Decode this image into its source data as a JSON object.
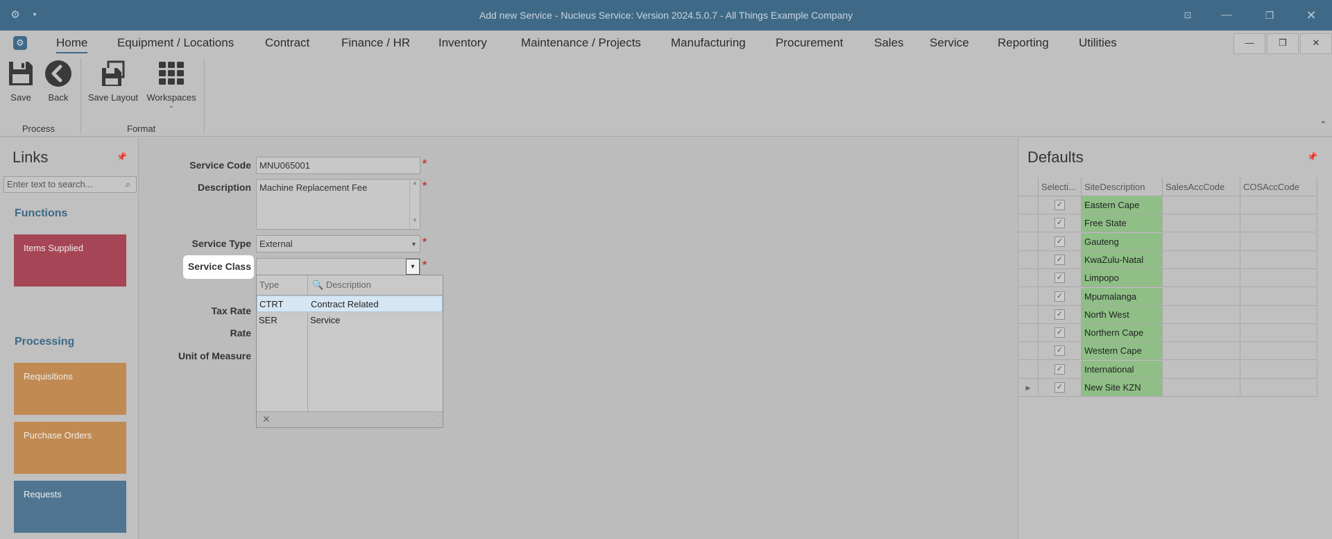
{
  "window": {
    "title": "Add new Service - Nucleus Service: Version 2024.5.0.7 - All Things Example Company"
  },
  "menu": {
    "tabs": [
      "Home",
      "Equipment / Locations",
      "Contract",
      "Finance / HR",
      "Inventory",
      "Maintenance / Projects",
      "Manufacturing",
      "Procurement",
      "Sales",
      "Service",
      "Reporting",
      "Utilities"
    ]
  },
  "ribbon": {
    "save": "Save",
    "back": "Back",
    "save_layout": "Save Layout",
    "workspaces": "Workspaces",
    "group_process": "Process",
    "group_format": "Format"
  },
  "links": {
    "title": "Links",
    "search_placeholder": "Enter text to search...",
    "functions_header": "Functions",
    "processing_header": "Processing",
    "tiles": {
      "items_supplied": "Items Supplied",
      "requisitions": "Requisitions",
      "purchase_orders": "Purchase Orders",
      "requests": "Requests"
    },
    "colors": {
      "items_supplied": "#a64555",
      "requisitions": "#c18a52",
      "purchase_orders": "#c18a52",
      "requests": "#4f7590"
    }
  },
  "form": {
    "service_code_label": "Service Code",
    "service_code_value": "MNU065001",
    "description_label": "Description",
    "description_value": "Machine Replacement Fee",
    "service_type_label": "Service Type",
    "service_type_value": "External",
    "service_class_label": "Service Class",
    "service_class_value": "",
    "tax_rate_label": "Tax Rate",
    "rate_label": "Rate",
    "uom_label": "Unit of Measure",
    "required_mark": "*"
  },
  "dropdown": {
    "col_type": "Type",
    "col_description": "Description",
    "rows": [
      {
        "type": "CTRT",
        "description": "Contract Related"
      },
      {
        "type": "SER",
        "description": "Service"
      }
    ]
  },
  "defaults": {
    "title": "Defaults",
    "columns": [
      "Selecti...",
      "SiteDescription",
      "SalesAccCode",
      "COSAccCode"
    ],
    "rows": [
      {
        "selected": true,
        "site": "Eastern Cape"
      },
      {
        "selected": true,
        "site": "Free State"
      },
      {
        "selected": true,
        "site": "Gauteng"
      },
      {
        "selected": true,
        "site": "KwaZulu-Natal"
      },
      {
        "selected": true,
        "site": "Limpopo"
      },
      {
        "selected": true,
        "site": "Mpumalanga"
      },
      {
        "selected": true,
        "site": "North West"
      },
      {
        "selected": true,
        "site": "Northern Cape"
      },
      {
        "selected": true,
        "site": "Western Cape"
      },
      {
        "selected": true,
        "site": "International"
      },
      {
        "selected": true,
        "site": "New Site KZN"
      }
    ],
    "site_color": "#8fbf86"
  }
}
